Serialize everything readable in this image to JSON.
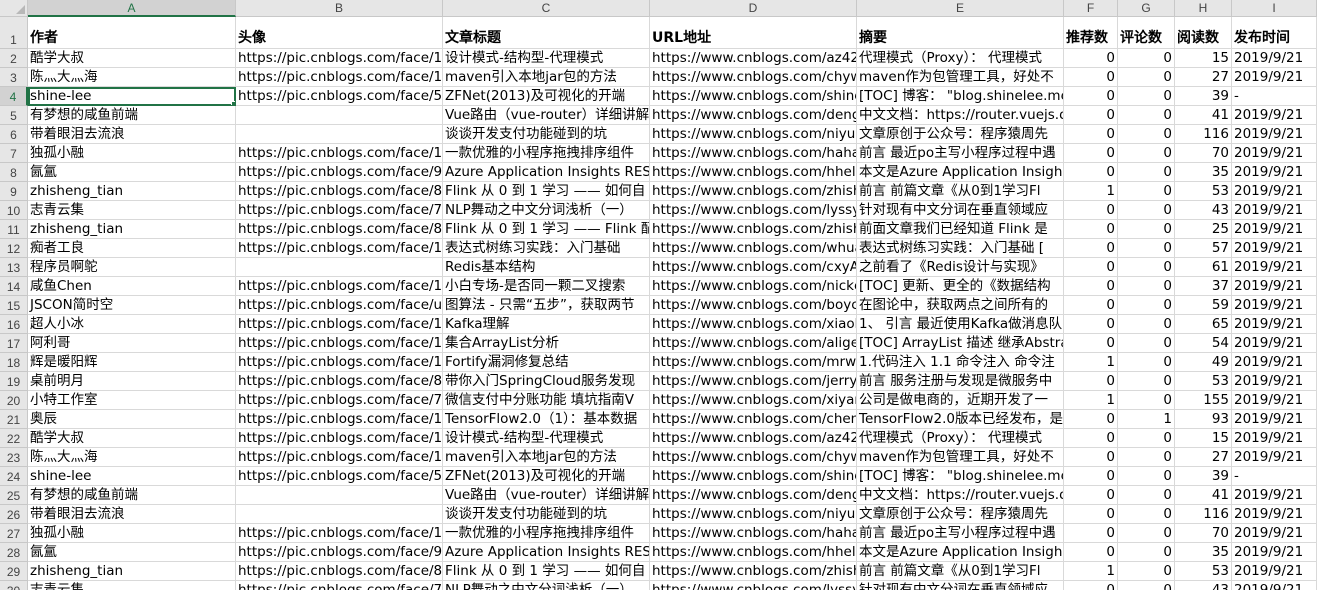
{
  "columns": [
    "A",
    "B",
    "C",
    "D",
    "E",
    "F",
    "G",
    "H",
    "I"
  ],
  "selected_cell": {
    "row": 4,
    "col": "A"
  },
  "header": [
    "作者",
    "头像",
    "文章标题",
    "URL地址",
    "摘要",
    "推荐数",
    "评论数",
    "阅读数",
    "发布时间"
  ],
  "rows": [
    {
      "n": "2",
      "cells": [
        "酷学大叔",
        "https://pic.cnblogs.com/face/14",
        "设计模式-结构型-代理模式",
        "https://www.cnblogs.com/az42",
        "代理模式（Proxy）： 代理模式",
        "0",
        "0",
        "15",
        "2019/9/21"
      ]
    },
    {
      "n": "3",
      "cells": [
        "陈灬大灬海",
        "https://pic.cnblogs.com/face/11",
        "maven引入本地jar包的方法",
        "https://www.cnblogs.com/chyw",
        "maven作为包管理工具，好处不",
        "0",
        "0",
        "27",
        "2019/9/21"
      ]
    },
    {
      "n": "4",
      "cells": [
        "shine-lee",
        "https://pic.cnblogs.com/face/58",
        "ZFNet(2013)及可视化的开端",
        "https://www.cnblogs.com/shine",
        "[TOC] 博客： \"blog.shinelee.me",
        "0",
        "0",
        "39",
        "-"
      ]
    },
    {
      "n": "5",
      "cells": [
        "有梦想的咸鱼前端",
        "",
        "Vue路由（vue-router）详细讲解",
        "https://www.cnblogs.com/deng",
        "中文文档：https://router.vuejs.o",
        "0",
        "0",
        "41",
        "2019/9/21"
      ]
    },
    {
      "n": "6",
      "cells": [
        "带着眼泪去流浪",
        "",
        "谈谈开发支付功能碰到的坑",
        "https://www.cnblogs.com/niyue",
        "文章原创于公众号：程序猿周先",
        "0",
        "0",
        "116",
        "2019/9/21"
      ]
    },
    {
      "n": "7",
      "cells": [
        "独孤小融",
        "https://pic.cnblogs.com/face/10",
        "一款优雅的小程序拖拽排序组件",
        "https://www.cnblogs.com/haha",
        "前言 最近po主写小程序过程中遇",
        "0",
        "0",
        "70",
        "2019/9/21"
      ]
    },
    {
      "n": "8",
      "cells": [
        "氤氲",
        "https://pic.cnblogs.com/face/99",
        "Azure Application Insights REST",
        "https://www.cnblogs.com/hheli",
        "本文是Azure Application Insigh",
        "0",
        "0",
        "35",
        "2019/9/21"
      ]
    },
    {
      "n": "9",
      "cells": [
        "zhisheng_tian",
        "https://pic.cnblogs.com/face/86",
        "Flink 从 0 到 1 学习 —— 如何自",
        "https://www.cnblogs.com/zhish",
        "前言 前篇文章《从0到1学习Fl",
        "1",
        "0",
        "53",
        "2019/9/21"
      ]
    },
    {
      "n": "10",
      "cells": [
        "志青云集",
        "https://pic.cnblogs.com/face/79",
        "NLP舞动之中文分词浅析（一）",
        "https://www.cnblogs.com/lyssy",
        "针对现有中文分词在垂直领域应",
        "0",
        "0",
        "43",
        "2019/9/21"
      ]
    },
    {
      "n": "11",
      "cells": [
        "zhisheng_tian",
        "https://pic.cnblogs.com/face/86",
        "Flink 从 0 到 1 学习 —— Flink 配",
        "https://www.cnblogs.com/zhish",
        "前面文章我们已经知道 Flink 是",
        "0",
        "0",
        "25",
        "2019/9/21"
      ]
    },
    {
      "n": "12",
      "cells": [
        "痴者工良",
        "https://pic.cnblogs.com/face/13",
        "表达式树练习实践：入门基础",
        "https://www.cnblogs.com/whua",
        "表达式树练习实践：入门基础 [",
        "0",
        "0",
        "57",
        "2019/9/21"
      ]
    },
    {
      "n": "13",
      "cells": [
        "程序员啊鸵",
        "",
        "Redis基本结构",
        "https://www.cnblogs.com/cxyA",
        "之前看了《Redis设计与实现》",
        "0",
        "0",
        "61",
        "2019/9/21"
      ]
    },
    {
      "n": "14",
      "cells": [
        "咸鱼Chen",
        "https://pic.cnblogs.com/face/15",
        "小白专场-是否同一颗二叉搜索",
        "https://www.cnblogs.com/nickc",
        "[TOC] 更新、更全的《数据结构",
        "0",
        "0",
        "37",
        "2019/9/21"
      ]
    },
    {
      "n": "15",
      "cells": [
        "JSCON简时空",
        "https://pic.cnblogs.com/face/u3",
        "图算法 - 只需“五步”，获取两节",
        "https://www.cnblogs.com/boyc",
        "在图论中，获取两点之间所有的",
        "0",
        "0",
        "59",
        "2019/9/21"
      ]
    },
    {
      "n": "16",
      "cells": [
        "超人小冰",
        "https://pic.cnblogs.com/face/17",
        "Kafka理解",
        "https://www.cnblogs.com/xiaob",
        "1、 引言 最近使用Kafka做消息队",
        "0",
        "0",
        "65",
        "2019/9/21"
      ]
    },
    {
      "n": "17",
      "cells": [
        "阿利哥",
        "https://pic.cnblogs.com/face/17",
        "集合ArrayList分析",
        "https://www.cnblogs.com/alige",
        "[TOC] ArrayList 描述 继承Abstra",
        "0",
        "0",
        "54",
        "2019/9/21"
      ]
    },
    {
      "n": "18",
      "cells": [
        "辉是暖阳辉",
        "https://pic.cnblogs.com/face/16",
        "Fortify漏洞修复总结",
        "https://www.cnblogs.com/mrwh",
        "1.代码注入 1.1 命令注入 命令注",
        "1",
        "0",
        "49",
        "2019/9/21"
      ]
    },
    {
      "n": "19",
      "cells": [
        "桌前明月",
        "https://pic.cnblogs.com/face/83",
        "带你入门SpringCloud服务发现",
        "https://www.cnblogs.com/jerry",
        "前言 服务注册与发现是微服务中",
        "0",
        "0",
        "53",
        "2019/9/21"
      ]
    },
    {
      "n": "20",
      "cells": [
        "小特工作室",
        "https://pic.cnblogs.com/face/70",
        "微信支付中分账功能 填坑指南V",
        "https://www.cnblogs.com/xiyar",
        "公司是做电商的，近期开发了一",
        "1",
        "0",
        "155",
        "2019/9/21"
      ]
    },
    {
      "n": "21",
      "cells": [
        "奥辰",
        "https://pic.cnblogs.com/face/15",
        "TensorFlow2.0（1）：基本数据",
        "https://www.cnblogs.com/chen",
        "TensorFlow2.0版本已经发布，是",
        "0",
        "1",
        "93",
        "2019/9/21"
      ]
    },
    {
      "n": "22",
      "cells": [
        "酷学大叔",
        "https://pic.cnblogs.com/face/14",
        "设计模式-结构型-代理模式",
        "https://www.cnblogs.com/az42",
        "代理模式（Proxy）： 代理模式",
        "0",
        "0",
        "15",
        "2019/9/21"
      ]
    },
    {
      "n": "23",
      "cells": [
        "陈灬大灬海",
        "https://pic.cnblogs.com/face/11",
        "maven引入本地jar包的方法",
        "https://www.cnblogs.com/chyw",
        "maven作为包管理工具，好处不",
        "0",
        "0",
        "27",
        "2019/9/21"
      ]
    },
    {
      "n": "24",
      "cells": [
        "shine-lee",
        "https://pic.cnblogs.com/face/58",
        "ZFNet(2013)及可视化的开端",
        "https://www.cnblogs.com/shine",
        "[TOC] 博客： \"blog.shinelee.me",
        "0",
        "0",
        "39",
        "-"
      ]
    },
    {
      "n": "25",
      "cells": [
        "有梦想的咸鱼前端",
        "",
        "Vue路由（vue-router）详细讲解",
        "https://www.cnblogs.com/deng",
        "中文文档：https://router.vuejs.o",
        "0",
        "0",
        "41",
        "2019/9/21"
      ]
    },
    {
      "n": "26",
      "cells": [
        "带着眼泪去流浪",
        "",
        "谈谈开发支付功能碰到的坑",
        "https://www.cnblogs.com/niyue",
        "文章原创于公众号：程序猿周先",
        "0",
        "0",
        "116",
        "2019/9/21"
      ]
    },
    {
      "n": "27",
      "cells": [
        "独孤小融",
        "https://pic.cnblogs.com/face/10",
        "一款优雅的小程序拖拽排序组件",
        "https://www.cnblogs.com/haha",
        "前言 最近po主写小程序过程中遇",
        "0",
        "0",
        "70",
        "2019/9/21"
      ]
    },
    {
      "n": "28",
      "cells": [
        "氤氲",
        "https://pic.cnblogs.com/face/99",
        "Azure Application Insights REST",
        "https://www.cnblogs.com/hheli",
        "本文是Azure Application Insigh",
        "0",
        "0",
        "35",
        "2019/9/21"
      ]
    },
    {
      "n": "29",
      "cells": [
        "zhisheng_tian",
        "https://pic.cnblogs.com/face/86",
        "Flink 从 0 到 1 学习 —— 如何自",
        "https://www.cnblogs.com/zhish",
        "前言 前篇文章《从0到1学习Fl",
        "1",
        "0",
        "53",
        "2019/9/21"
      ]
    },
    {
      "n": "30",
      "cells": [
        "志青云集",
        "https://pic.cnblogs.com/face/79",
        "NLP舞动之中文分词浅析（一）",
        "https://www.cnblogs.com/lyssy",
        "针对现有中文分词在垂直领域应",
        "0",
        "0",
        "43",
        "2019/9/21"
      ]
    }
  ]
}
